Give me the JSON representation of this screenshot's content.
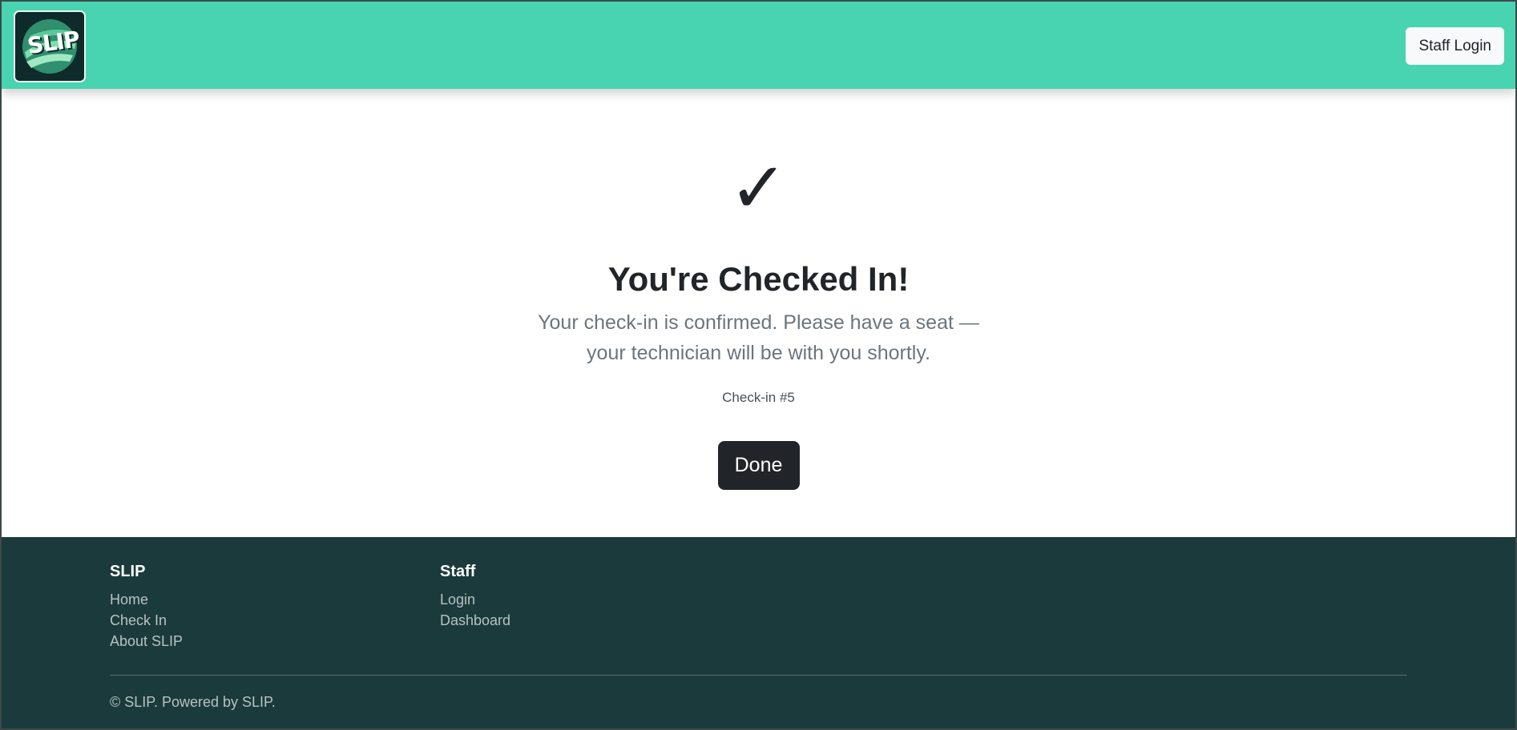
{
  "header": {
    "logo_text": "SLIP",
    "staff_login_label": "Staff Login",
    "brand_color": "#48d4b1"
  },
  "confirmation": {
    "check_mark": "✓",
    "title": "You're Checked In!",
    "message": "Your check-in is confirmed. Please have a seat — your technician will be with you shortly.",
    "checkin_number": "Check-in #5",
    "done_label": "Done"
  },
  "footer": {
    "columns": [
      {
        "heading": "SLIP",
        "links": [
          "Home",
          "Check In",
          "About SLIP"
        ]
      },
      {
        "heading": "Staff",
        "links": [
          "Login",
          "Dashboard"
        ]
      }
    ],
    "copyright": "© SLIP. Powered by SLIP.",
    "background_color": "#1b3a3b"
  }
}
